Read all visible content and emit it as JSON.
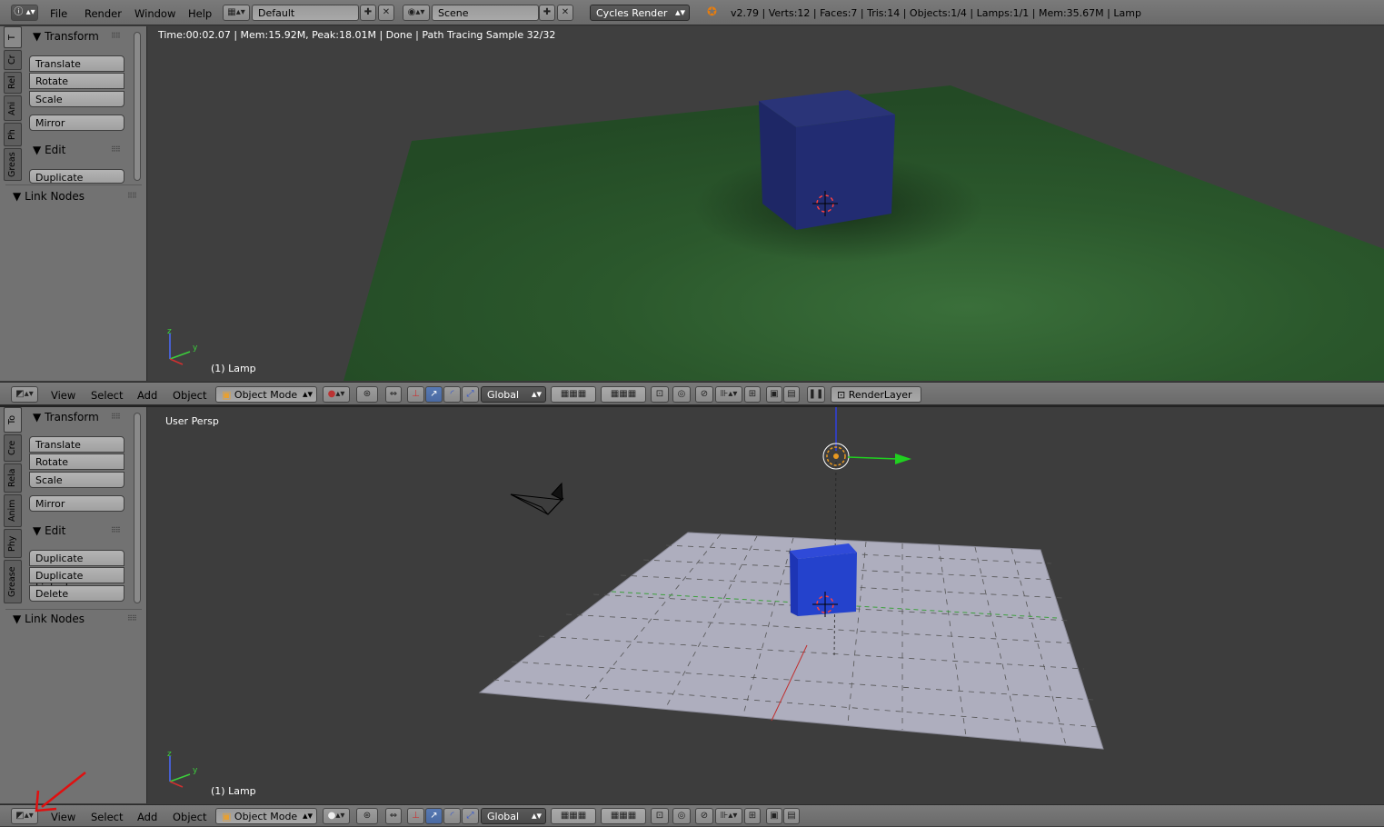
{
  "info_header": {
    "menus": [
      "File",
      "Render",
      "Window",
      "Help"
    ],
    "layout_value": "Default",
    "scene_value": "Scene",
    "render_engine": "Cycles Render",
    "stats": "v2.79 | Verts:12 | Faces:7 | Tris:14 | Objects:1/4 | Lamps:1/1 | Mem:35.67M | Lamp"
  },
  "top_panel": {
    "tabs": [
      "T",
      "Cr",
      "Rel",
      "Ani",
      "Ph",
      "Greas"
    ],
    "transform_title": "Transform",
    "transform_buttons": [
      "Translate",
      "Rotate",
      "Scale"
    ],
    "mirror": "Mirror",
    "edit_title": "Edit",
    "edit_buttons": [
      "Duplicate"
    ],
    "link_nodes": "Link Nodes"
  },
  "top_viewport": {
    "render_status": "Time:00:02.07 | Mem:15.92M, Peak:18.01M | Done | Path Tracing Sample 32/32",
    "object_label": "(1) Lamp",
    "axis_z": "z",
    "axis_y": "y"
  },
  "view_header": {
    "menus": [
      "View",
      "Select",
      "Add",
      "Object"
    ],
    "mode": "Object Mode",
    "orientation": "Global",
    "render_layer": "RenderLayer"
  },
  "bottom_panel": {
    "tabs": [
      "To",
      "Cre",
      "Rela",
      "Anim",
      "Phy",
      "Grease"
    ],
    "transform_title": "Transform",
    "transform_buttons": [
      "Translate",
      "Rotate",
      "Scale"
    ],
    "mirror": "Mirror",
    "edit_title": "Edit",
    "edit_buttons": [
      "Duplicate",
      "Duplicate Linked",
      "Delete"
    ],
    "link_nodes": "Link Nodes"
  },
  "bottom_viewport": {
    "view_name": "User Persp",
    "object_label": "(1) Lamp",
    "axis_z": "z",
    "axis_y": "y"
  },
  "colors": {
    "header_bg": "#727272",
    "panel_bg": "#727272",
    "viewport_bg": "#3d3d3d",
    "accent_blue": "#5779b3",
    "annotation_arrow": "#e01010"
  }
}
